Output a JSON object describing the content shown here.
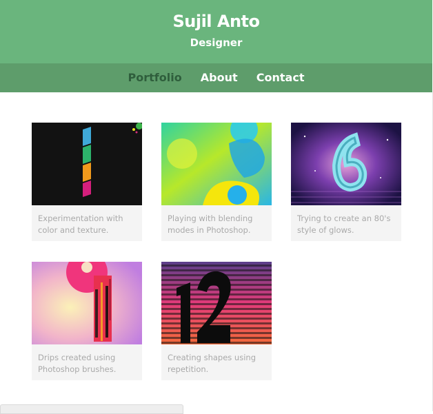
{
  "header": {
    "title": "Sujil Anto",
    "subtitle": "Designer"
  },
  "nav": {
    "items": [
      "Portfolio",
      "About",
      "Contact"
    ],
    "active": "Portfolio"
  },
  "portfolio": [
    {
      "caption": "Experimentation with color and texture."
    },
    {
      "caption": "Playing with blending modes in Photoshop."
    },
    {
      "caption": "Trying to create an 80's style of glows."
    },
    {
      "caption": "Drips created using Photoshop brushes."
    },
    {
      "caption": "Creating shapes using repetition."
    }
  ],
  "colors": {
    "header_bg": "#6ab57d",
    "nav_bg": "#5e9d6b",
    "nav_active": "#2f5e3c",
    "caption_bg": "#f4f4f4"
  }
}
